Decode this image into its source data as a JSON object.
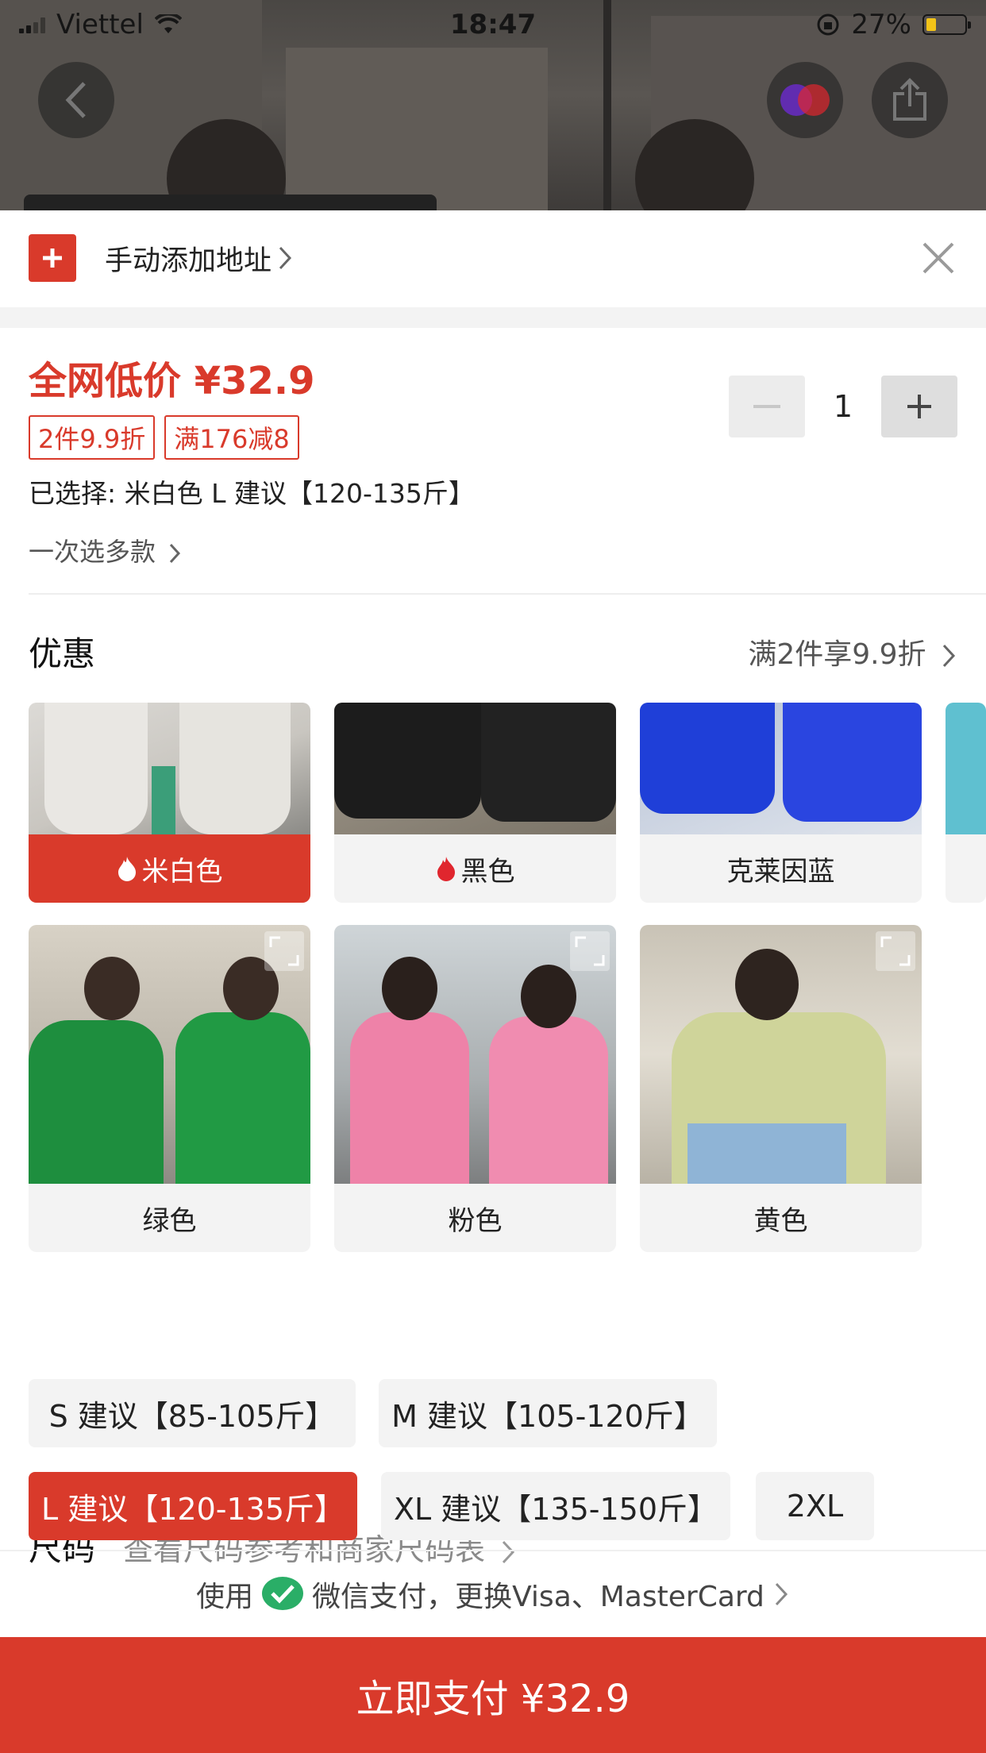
{
  "status_bar": {
    "carrier": "Viettel",
    "time": "18:47",
    "battery": "27%",
    "battery_level": 0.27
  },
  "address": {
    "label": "手动添加地址"
  },
  "product": {
    "price": "全网低价 ¥32.9",
    "tags": [
      "2件9.9折",
      "满176减8"
    ],
    "selected": "已选择: 米白色 L 建议【120-135斤】",
    "multi_select": "一次选多款",
    "quantity": "1"
  },
  "promo": {
    "title": "优惠",
    "link": "满2件享9.9折"
  },
  "colors": [
    {
      "label": "米白色",
      "hot": true,
      "selected": true
    },
    {
      "label": "黑色",
      "hot": true,
      "selected": false
    },
    {
      "label": "克莱因蓝",
      "hot": false,
      "selected": false
    },
    {
      "label": "绿色",
      "hot": false,
      "selected": false
    },
    {
      "label": "粉色",
      "hot": false,
      "selected": false
    },
    {
      "label": "黄色",
      "hot": false,
      "selected": false
    }
  ],
  "size": {
    "title": "尺码",
    "link": "查看尺码参考和商家尺码表",
    "options": [
      {
        "label": "S 建议【85-105斤】",
        "selected": false
      },
      {
        "label": "M 建议【105-120斤】",
        "selected": false
      },
      {
        "label": "L 建议【120-135斤】",
        "selected": true
      },
      {
        "label": "XL 建议【135-150斤】",
        "selected": false
      },
      {
        "label": "2XL",
        "selected": false
      }
    ]
  },
  "payment": {
    "prefix": "使用",
    "method": "微信支付，更换Visa、MasterCard",
    "button": "立即支付 ¥32.9"
  },
  "colors_theme": {
    "accent": "#d93a2b",
    "chip_bg": "#f3f3f3"
  }
}
